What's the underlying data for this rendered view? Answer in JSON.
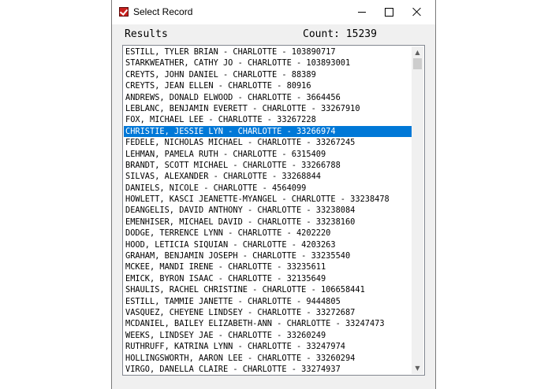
{
  "window": {
    "title": "Select Record"
  },
  "header": {
    "results_label": "Results",
    "count_label": "Count:",
    "count_value": "15239"
  },
  "records": [
    "ESTILL, TYLER BRIAN - CHARLOTTE - 103890717",
    "STARKWEATHER, CATHY JO - CHARLOTTE - 103893001",
    "CREYTS, JOHN DANIEL - CHARLOTTE - 88389",
    "CREYTS, JEAN ELLEN - CHARLOTTE - 80916",
    "ANDREWS, DONALD ELWOOD - CHARLOTTE - 3664456",
    "LEBLANC, BENJAMIN EVERETT - CHARLOTTE - 33267910",
    "FOX, MICHAEL LEE - CHARLOTTE - 33267228",
    "CHRISTIE, JESSIE LYN - CHARLOTTE - 33266974",
    "FEDELE, NICHOLAS MICHAEL - CHARLOTTE - 33267245",
    "LEHMAN, PAMELA RUTH - CHARLOTTE - 6315409",
    "BRANDT, SCOTT MICHAEL - CHARLOTTE - 33266788",
    "SILVAS, ALEXANDER - CHARLOTTE - 33268844",
    "DANIELS, NICOLE - CHARLOTTE - 4564099",
    "HOWLETT, KASCI JEANETTE-MYANGEL - CHARLOTTE - 33238478",
    "DEANGELIS, DAVID ANTHONY - CHARLOTTE - 33238084",
    "EMENHISER, MICHAEL DAVID - CHARLOTTE - 33238160",
    "DODGE, TERRENCE LYNN - CHARLOTTE - 4202220",
    "HOOD, LETICIA SIQUIAN - CHARLOTTE - 4203263",
    "GRAHAM, BENJAMIN JOSEPH - CHARLOTTE - 33235540",
    "MCKEE, MANDI IRENE - CHARLOTTE - 33235611",
    "EMICK, BYRON ISAAC - CHARLOTTE - 32135649",
    "SHAULIS, RACHEL CHRISTINE - CHARLOTTE - 106658441",
    "ESTILL, TAMMIE JANETTE - CHARLOTTE - 9444805",
    "VASQUEZ, CHEYENE LINDSEY - CHARLOTTE - 33272687",
    "MCDANIEL, BAILEY ELIZABETH-ANN - CHARLOTTE - 33247473",
    "WEEKS, LINDSEY JAE - CHARLOTTE - 33260249",
    "RUTHRUFF, KATRINA LYNN - CHARLOTTE - 33247974",
    "HOLLINGSWORTH, AARON LEE - CHARLOTTE - 33260294",
    "VIRGO, DANELLA CLAIRE - CHARLOTTE - 33274937"
  ],
  "selected_index": 7,
  "colors": {
    "selection": "#0078d7",
    "icon_red": "#c8201e"
  },
  "icons": {
    "app": "checkbox-icon",
    "minimize": "minimize-icon",
    "maximize": "maximize-icon",
    "close": "close-icon",
    "scroll_up": "scroll-up-arrow-icon",
    "scroll_down": "scroll-down-arrow-icon"
  }
}
